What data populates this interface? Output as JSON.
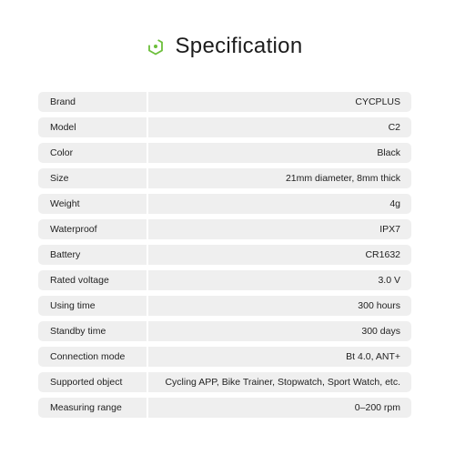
{
  "header": {
    "title": "Specification",
    "icon": "hexagon-dot-icon",
    "accent_color": "#6cbf3a"
  },
  "specs": [
    {
      "label": "Brand",
      "value": "CYCPLUS"
    },
    {
      "label": "Model",
      "value": "C2"
    },
    {
      "label": "Color",
      "value": "Black"
    },
    {
      "label": "Size",
      "value": "21mm diameter, 8mm thick"
    },
    {
      "label": "Weight",
      "value": "4g"
    },
    {
      "label": "Waterproof",
      "value": "IPX7"
    },
    {
      "label": "Battery",
      "value": "CR1632"
    },
    {
      "label": "Rated voltage",
      "value": "3.0 V"
    },
    {
      "label": "Using time",
      "value": "300 hours"
    },
    {
      "label": "Standby time",
      "value": "300 days"
    },
    {
      "label": "Connection mode",
      "value": "Bt 4.0, ANT+"
    },
    {
      "label": "Supported object",
      "value": "Cycling APP, Bike Trainer, Stopwatch, Sport Watch, etc."
    },
    {
      "label": "Measuring range",
      "value": "0–200 rpm"
    }
  ]
}
